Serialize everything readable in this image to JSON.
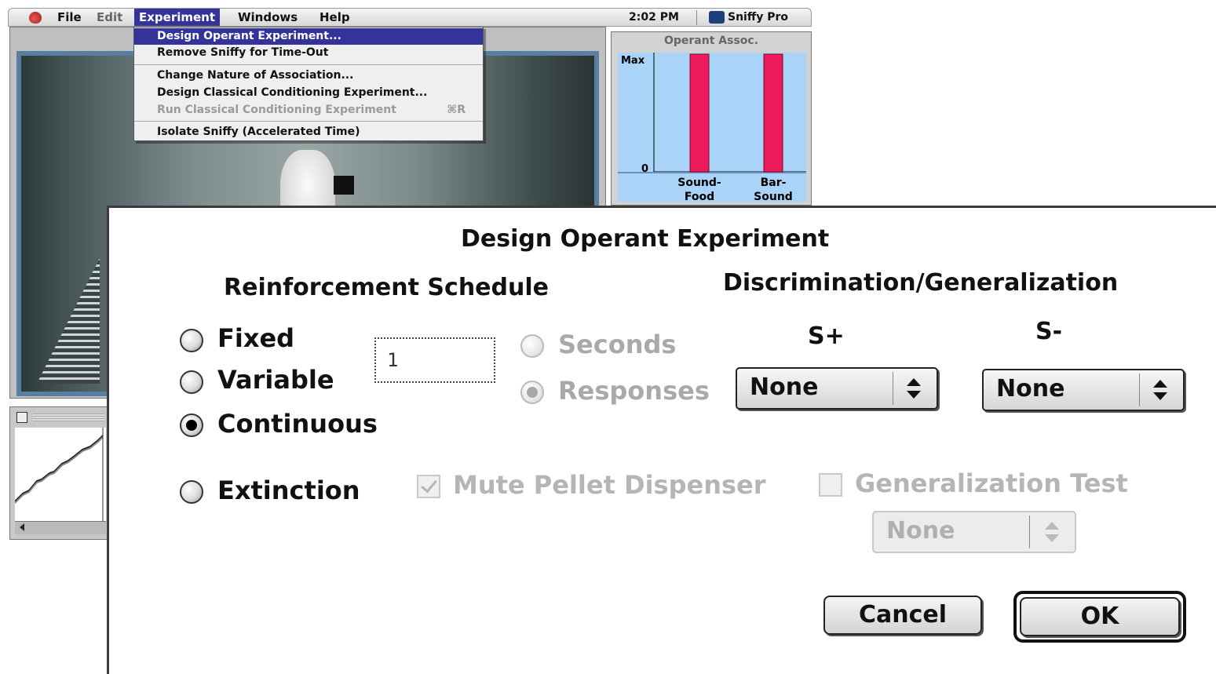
{
  "menubar": {
    "items": [
      "File",
      "Edit",
      "Experiment",
      "Windows",
      "Help"
    ],
    "time": "2:02 PM",
    "app_name": "Sniffy Pro"
  },
  "experiment_menu": {
    "items": [
      "Design Operant Experiment...",
      "Remove Sniffy for Time-Out",
      "Change Nature of Association...",
      "Design Classical Conditioning Experiment...",
      "Run Classical Conditioning Experiment",
      "Isolate Sniffy (Accelerated Time)"
    ],
    "shortcut_run": "⌘R"
  },
  "assoc_window": {
    "title": "Operant Assoc."
  },
  "chart_data": {
    "type": "bar",
    "title": "Operant Assoc.",
    "categories": [
      "Sound-Food",
      "Bar-Sound"
    ],
    "category_lines": [
      [
        "Sound-",
        "Food"
      ],
      [
        "Bar-",
        "Sound"
      ]
    ],
    "values": [
      1.0,
      1.0
    ],
    "y_tick_labels": [
      "Max",
      "0"
    ],
    "ylim": [
      0,
      1
    ],
    "bar_color": "#ef1a5e",
    "background": "#a9d4f8"
  },
  "dialog": {
    "title": "Design Operant Experiment",
    "schedule_heading": "Reinforcement Schedule",
    "schedule_options": [
      "Fixed",
      "Variable",
      "Continuous",
      "Extinction"
    ],
    "selected_schedule": "Continuous",
    "interval_value": "1",
    "unit_options": [
      "Seconds",
      "Responses"
    ],
    "selected_unit": "Responses",
    "discrimination_heading": "Discrimination/Generalization",
    "s_plus_label": "S+",
    "s_minus_label": "S-",
    "s_plus_value": "None",
    "s_minus_value": "None",
    "mute_pellet_label": "Mute Pellet Dispenser",
    "generalization_label": "Generalization Test",
    "generalization_value": "None",
    "cancel_label": "Cancel",
    "ok_label": "OK"
  },
  "colors": {
    "menu_highlight": "#33339a",
    "disabled_text": "#a9a9a9"
  }
}
